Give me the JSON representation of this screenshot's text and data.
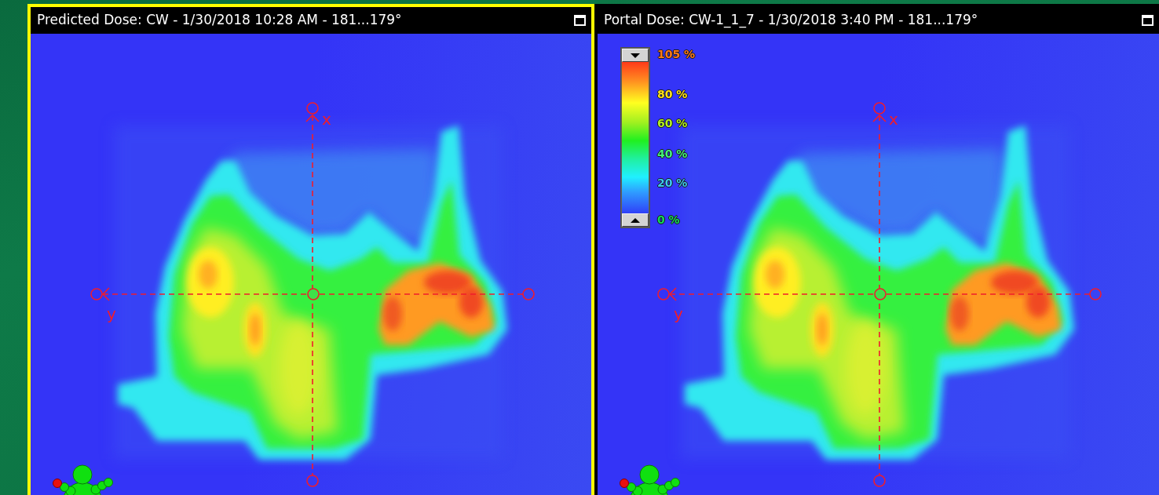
{
  "panels": [
    {
      "title": "Predicted Dose: CW - 1/30/2018 10:28 AM - 181...179°",
      "selected": true,
      "axis_labels": {
        "vertical": "x",
        "horizontal": "y"
      }
    },
    {
      "title": "Portal Dose: CW-1_1_7 - 1/30/2018 3:40 PM - 181...179°",
      "selected": false,
      "axis_labels": {
        "vertical": "x",
        "horizontal": "y"
      },
      "legend": {
        "labels": [
          {
            "text": "105 %",
            "color": "#ff7a1a"
          },
          {
            "text": "80 %",
            "color": "#ffe21a"
          },
          {
            "text": "60 %",
            "color": "#b4f022"
          },
          {
            "text": "40 %",
            "color": "#44f07a"
          },
          {
            "text": "20 %",
            "color": "#3cc8f0"
          },
          {
            "text": "0 %",
            "color": "#14d85a"
          }
        ]
      }
    }
  ]
}
